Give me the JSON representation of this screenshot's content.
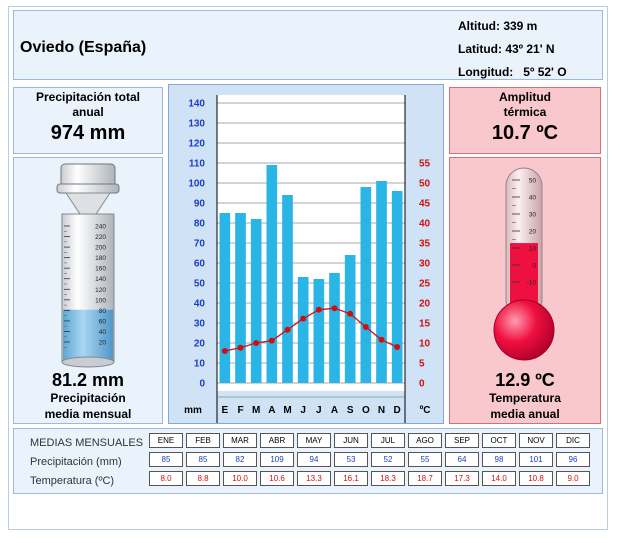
{
  "header": {
    "city": "Oviedo (España)",
    "altitude": "Altitud: 339 m",
    "latitude": "Latitud: 43º 21' N",
    "longitude": "Longitud:   5º 52' O"
  },
  "precip_total": {
    "label_line1": "Precipitación total",
    "label_line2": "anual",
    "value": "974 mm"
  },
  "precip_mean": {
    "value": "81.2 mm",
    "label_line1": "Precipitación",
    "label_line2": "media mensual",
    "gauge_ticks": [
      "240",
      "220",
      "200",
      "180",
      "160",
      "140",
      "120",
      "100",
      "80",
      "60",
      "40",
      "20"
    ],
    "gauge_level": 81.2
  },
  "amplitude": {
    "label_line1": "Amplitud",
    "label_line2": "térmica",
    "value": "10.7 ºC"
  },
  "temp_mean": {
    "value": "12.9 ºC",
    "label_line1": "Temperatura",
    "label_line2": "media anual",
    "thermo_ticks": [
      "50",
      "40",
      "30",
      "20",
      "10",
      "0",
      "-10"
    ],
    "thermo_level": 12.9
  },
  "colors": {
    "bar": "#29b6e6",
    "line": "#d01010",
    "left_axis": "#1a3fbf",
    "right_axis": "#d01010"
  },
  "chart_data": {
    "type": "bar",
    "categories": [
      "E",
      "F",
      "M",
      "A",
      "M",
      "J",
      "J",
      "A",
      "S",
      "O",
      "N",
      "D"
    ],
    "series": [
      {
        "values": [
          85,
          85,
          82,
          109,
          94,
          53,
          52,
          55,
          64,
          98,
          101,
          96
        ],
        "axis": "left"
      },
      {
        "type": "line",
        "values": [
          8.0,
          8.8,
          10.0,
          10.6,
          13.3,
          16.1,
          18.3,
          18.7,
          17.3,
          14.0,
          10.8,
          9.0
        ],
        "axis": "right"
      }
    ],
    "xlabel_left": "mm",
    "xlabel_right": "ºC",
    "y_ticks": [
      "140",
      "130",
      "120",
      "110",
      "100",
      "90",
      "80",
      "70",
      "60",
      "50",
      "40",
      "30",
      "20",
      "10",
      "0"
    ],
    "y2_ticks": [
      "55",
      "50",
      "45",
      "40",
      "35",
      "30",
      "25",
      "20",
      "15",
      "10",
      "5",
      "0"
    ],
    "ylim": [
      0,
      140
    ],
    "y2lim": [
      0,
      70
    ],
    "grid": true
  },
  "table": {
    "title": "MEDIAS MENSUALES",
    "precip_label": "Precipitación (mm)",
    "temp_label": "Temperatura (ºC)",
    "months": [
      "ENE",
      "FEB",
      "MAR",
      "ABR",
      "MAY",
      "JUN",
      "JUL",
      "AGO",
      "SEP",
      "OCT",
      "NOV",
      "DIC"
    ],
    "precip": [
      "85",
      "85",
      "82",
      "109",
      "94",
      "53",
      "52",
      "55",
      "64",
      "98",
      "101",
      "96"
    ],
    "temp": [
      "8.0",
      "8.8",
      "10.0",
      "10.6",
      "13.3",
      "16.1",
      "18.3",
      "18.7",
      "17.3",
      "14.0",
      "10.8",
      "9.0"
    ]
  }
}
